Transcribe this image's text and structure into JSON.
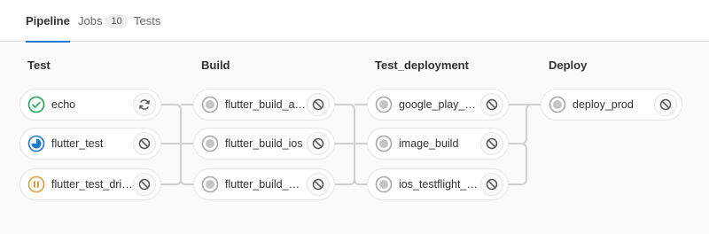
{
  "tabs": [
    {
      "label": "Pipeline",
      "active": true
    },
    {
      "label": "Jobs",
      "count": "10"
    },
    {
      "label": "Tests"
    }
  ],
  "stages": [
    {
      "title": "Test",
      "jobs": [
        {
          "name": "echo",
          "status": "success",
          "action": "retry"
        },
        {
          "name": "flutter_test",
          "status": "running",
          "action": "cancel"
        },
        {
          "name": "flutter_test_driver",
          "status": "paused",
          "action": "cancel"
        }
      ]
    },
    {
      "title": "Build",
      "jobs": [
        {
          "name": "flutter_build_an…",
          "status": "created",
          "action": "cancel"
        },
        {
          "name": "flutter_build_ios",
          "status": "created",
          "action": "cancel"
        },
        {
          "name": "flutter_build_web",
          "status": "created",
          "action": "cancel"
        }
      ]
    },
    {
      "title": "Test_deployment",
      "jobs": [
        {
          "name": "google_play_be…",
          "status": "created",
          "action": "cancel"
        },
        {
          "name": "image_build",
          "status": "created",
          "action": "cancel"
        },
        {
          "name": "ios_testflight_b…",
          "status": "created",
          "action": "cancel"
        }
      ]
    },
    {
      "title": "Deploy",
      "jobs": [
        {
          "name": "deploy_prod",
          "status": "created",
          "action": "cancel"
        }
      ]
    }
  ],
  "colors": {
    "success": "#1aaa55",
    "running": "#1f78d1",
    "paused": "#db9e38",
    "created": "#a7a7a7",
    "accent": "#1f78d1"
  }
}
